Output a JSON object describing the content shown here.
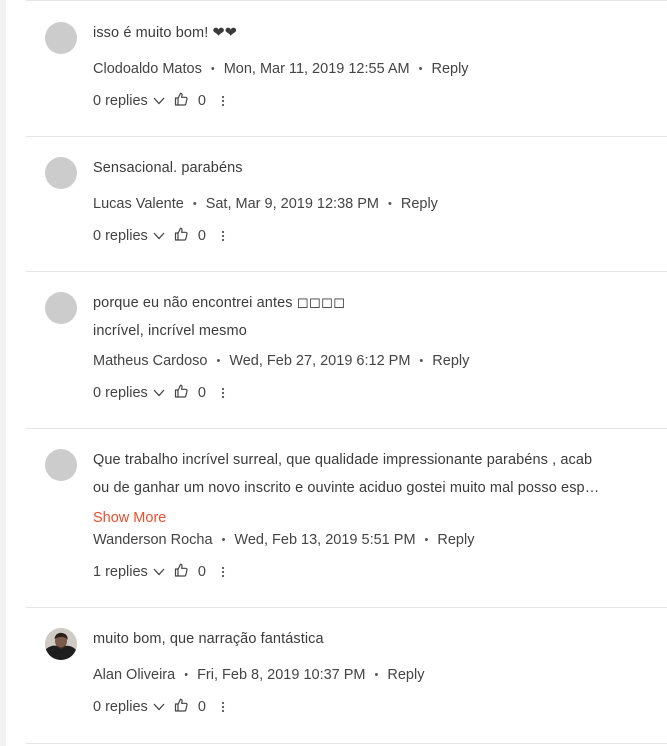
{
  "comments": [
    {
      "text_lines": [
        "isso é muito bom! ❤❤"
      ],
      "author": "Clodoaldo Matos",
      "date": "Mon, Mar 11, 2019 12:55 AM",
      "reply_label": "Reply",
      "replies": "0 replies",
      "likes": "0",
      "avatar": "placeholder"
    },
    {
      "text_lines": [
        "Sensacional. parabéns"
      ],
      "author": "Lucas Valente",
      "date": "Sat, Mar 9, 2019 12:38 PM",
      "reply_label": "Reply",
      "replies": "0 replies",
      "likes": "0",
      "avatar": "placeholder"
    },
    {
      "text_lines": [
        "porque eu não encontrei antes ◻◻◻◻",
        "incrível, incrível mesmo"
      ],
      "author": "Matheus Cardoso",
      "date": "Wed, Feb 27, 2019 6:12 PM",
      "reply_label": "Reply",
      "replies": "0 replies",
      "likes": "0",
      "avatar": "placeholder"
    },
    {
      "text_lines": [
        "Que trabalho incrível surreal, que qualidade impressionante parabéns , acab",
        "ou de ganhar um novo inscrito e ouvinte aciduo gostei muito mal posso esp…"
      ],
      "show_more": "Show More",
      "author": "Wanderson Rocha",
      "date": "Wed, Feb 13, 2019 5:51 PM",
      "reply_label": "Reply",
      "replies": "1 replies",
      "likes": "0",
      "avatar": "placeholder"
    },
    {
      "text_lines": [
        "muito bom, que narração fantástica"
      ],
      "author": "Alan Oliveira",
      "date": "Fri, Feb 8, 2019 10:37 PM",
      "reply_label": "Reply",
      "replies": "0 replies",
      "likes": "0",
      "avatar": "photo"
    }
  ],
  "icons": {
    "dot": "•",
    "chevron": "chevron-down-icon",
    "like": "thumbs-up-icon",
    "more": "more-vertical-icon"
  },
  "colors": {
    "show_more": "#e8502f",
    "avatar_placeholder": "#cccccc",
    "separator": "#e6e6e6"
  }
}
